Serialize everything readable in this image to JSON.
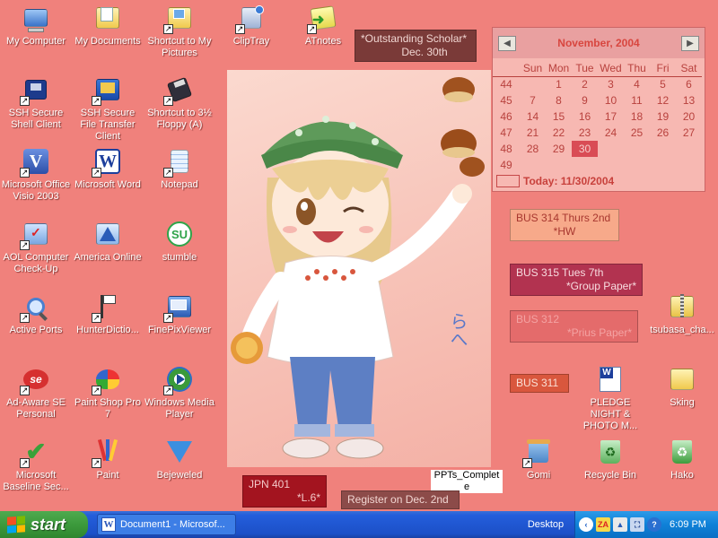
{
  "desktop_icons": [
    {
      "label": "My Computer"
    },
    {
      "label": "My Documents"
    },
    {
      "label": "Shortcut to My Pictures"
    },
    {
      "label": "ClipTray"
    },
    {
      "label": "ATnotes"
    },
    {
      "label": "SSH Secure Shell Client"
    },
    {
      "label": "SSH Secure File Transfer Client"
    },
    {
      "label": "Shortcut to 3½ Floppy (A)"
    },
    {
      "label": "Microsoft Office Visio 2003"
    },
    {
      "label": "Microsoft Word"
    },
    {
      "label": "Notepad"
    },
    {
      "label": "AOL Computer Check-Up"
    },
    {
      "label": "America Online"
    },
    {
      "label": "stumble"
    },
    {
      "label": "Active Ports"
    },
    {
      "label": "HunterDictio..."
    },
    {
      "label": "FinePixViewer"
    },
    {
      "label": "Ad-Aware SE Personal"
    },
    {
      "label": "Paint Shop Pro 7"
    },
    {
      "label": "Windows Media Player"
    },
    {
      "label": "Microsoft Baseline Sec..."
    },
    {
      "label": "Paint"
    },
    {
      "label": "Bejeweled"
    },
    {
      "label": "PPTs_Complete"
    },
    {
      "label": "Gomi"
    },
    {
      "label": "Recycle Bin"
    },
    {
      "label": "Hako"
    },
    {
      "label": "tsubasa_cha..."
    },
    {
      "label": "PLEDGE NIGHT & PHOTO M..."
    },
    {
      "label": "Sking"
    }
  ],
  "notes": {
    "scholar": {
      "line1": "*Outstanding Scholar*",
      "line2": "Dec. 30th"
    },
    "bus314": {
      "line1": "BUS 314 Thurs 2nd",
      "line2": "*HW"
    },
    "bus315": {
      "line1": "BUS 315 Tues 7th",
      "line2": "*Group Paper*"
    },
    "bus312": {
      "line1": "BUS 312",
      "line2": "*Prius Paper*"
    },
    "bus311": {
      "line1": "BUS 311"
    },
    "jpn401": {
      "line1": "JPN 401",
      "line2": "*L.6*"
    },
    "register": {
      "line1": "Register on Dec. 2nd"
    }
  },
  "calendar": {
    "month": "November, 2004",
    "prev": "◀",
    "next": "▶",
    "days_of_week": [
      "Sun",
      "Mon",
      "Tue",
      "Wed",
      "Thu",
      "Fri",
      "Sat"
    ],
    "weeks": [
      {
        "num": "44",
        "days": [
          "",
          "1",
          "2",
          "3",
          "4",
          "5",
          "6"
        ]
      },
      {
        "num": "45",
        "days": [
          "7",
          "8",
          "9",
          "10",
          "11",
          "12",
          "13"
        ]
      },
      {
        "num": "46",
        "days": [
          "14",
          "15",
          "16",
          "17",
          "18",
          "19",
          "20"
        ]
      },
      {
        "num": "47",
        "days": [
          "21",
          "22",
          "23",
          "24",
          "25",
          "26",
          "27"
        ]
      },
      {
        "num": "48",
        "days": [
          "28",
          "29",
          "30",
          "",
          "",
          "",
          ""
        ]
      },
      {
        "num": "49",
        "days": [
          "",
          "",
          "",
          "",
          "",
          "",
          ""
        ]
      }
    ],
    "selected_day": "30",
    "today": "Today: 11/30/2004"
  },
  "taskbar": {
    "start_label": "start",
    "task_button": "Document1 - Microsof...",
    "desktop_toolbar": "Desktop",
    "clock": "6:09 PM"
  },
  "wallpaper_text": "らへ",
  "colors": {
    "desktop_bg": "#f0817c",
    "note_dark": "#7a3a38",
    "note_maroon": "#b23350",
    "note_peach": "#f7a98a",
    "calendar_accent": "#d8463f"
  }
}
